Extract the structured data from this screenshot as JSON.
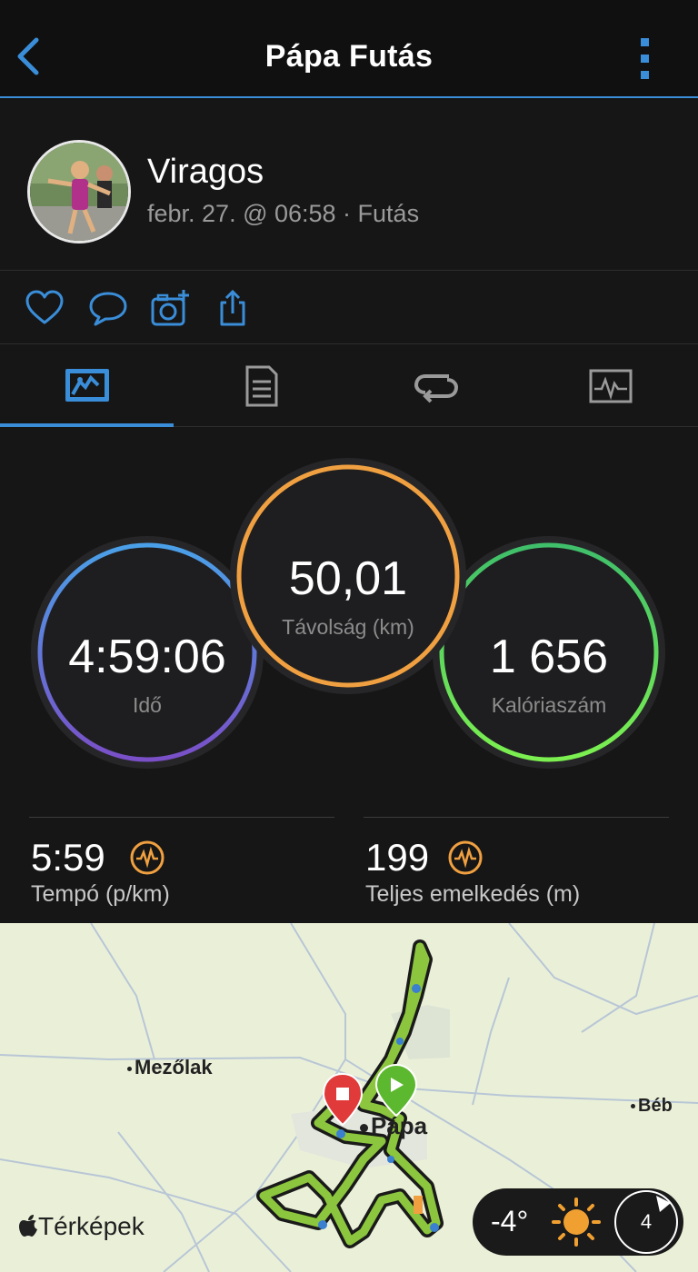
{
  "header": {
    "title": "Pápa Futás",
    "back_icon": "chevron-left-icon",
    "more_icon": "more-vertical-icon",
    "accent": "#3a8dd8"
  },
  "profile": {
    "username": "Viragos",
    "meta": "febr. 27. @ 06:58 · Futás"
  },
  "actions": [
    "heart-icon",
    "comment-icon",
    "add-photo-icon",
    "share-icon"
  ],
  "tabs": [
    {
      "icon": "overview-icon",
      "active": true
    },
    {
      "icon": "details-list-icon",
      "active": false
    },
    {
      "icon": "laps-icon",
      "active": false
    },
    {
      "icon": "charts-icon",
      "active": false
    }
  ],
  "stats": {
    "time": {
      "value": "4:59:06",
      "label": "Idő"
    },
    "distance": {
      "value": "50,01",
      "label": "Távolság (km)"
    },
    "calories": {
      "value": "1 656",
      "label": "Kalóriaszám"
    },
    "ring_colors": {
      "time": [
        "#4aa0e8",
        "#7a4fc8"
      ],
      "distance": [
        "#f0a040",
        "#f0a040"
      ],
      "calories": [
        "#3fbf6a",
        "#7cf050"
      ]
    }
  },
  "metrics": [
    {
      "value": "5:59",
      "label": "Tempó (p/km)",
      "icon": "pace-chart-icon"
    },
    {
      "value": "199",
      "label": "Teljes emelkedés (m)",
      "icon": "elevation-chart-icon"
    }
  ],
  "map": {
    "places": [
      "Mezőlak",
      "Pápa",
      "Béb"
    ],
    "brand": "Térképek",
    "temperature": "-4°",
    "weather_icon": "sun-icon",
    "wind_speed": "4"
  }
}
